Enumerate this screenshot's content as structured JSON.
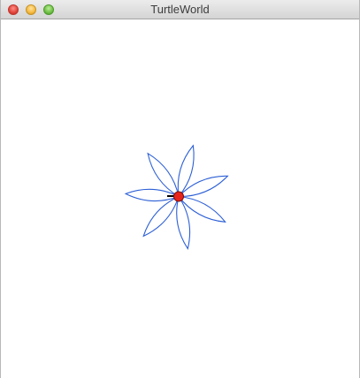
{
  "window": {
    "title": "TurtleWorld"
  },
  "controls": {
    "close": "close-button",
    "minimize": "minimize-button",
    "zoom": "zoom-button"
  },
  "drawing": {
    "petal_count": 7,
    "stroke_color": "#2c5fd6",
    "turtle_color": "#e8231d",
    "turtle_heading_color": "#000000"
  }
}
